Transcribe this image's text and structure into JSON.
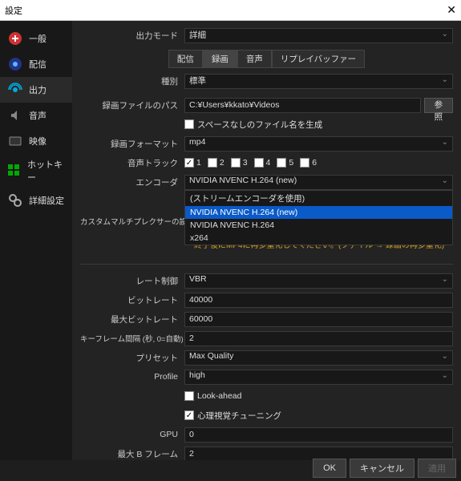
{
  "window": {
    "title": "設定"
  },
  "sidebar": {
    "items": [
      {
        "label": "一般",
        "icon": "general"
      },
      {
        "label": "配信",
        "icon": "stream"
      },
      {
        "label": "出力",
        "icon": "output"
      },
      {
        "label": "音声",
        "icon": "audio"
      },
      {
        "label": "映像",
        "icon": "video"
      },
      {
        "label": "ホットキー",
        "icon": "hotkey"
      },
      {
        "label": "詳細設定",
        "icon": "advanced"
      }
    ]
  },
  "outputMode": {
    "label": "出力モード",
    "value": "詳細"
  },
  "tabs": [
    "配信",
    "録画",
    "音声",
    "リプレイバッファー"
  ],
  "type": {
    "label": "種別",
    "value": "標準"
  },
  "recPath": {
    "label": "録画ファイルのパス",
    "value": "C:¥Users¥kkato¥Videos",
    "browse": "参照"
  },
  "noSpace": {
    "label": "スペースなしのファイル名を生成"
  },
  "recFormat": {
    "label": "録画フォーマット",
    "value": "mp4"
  },
  "audioTrack": {
    "label": "音声トラック",
    "tracks": [
      "1",
      "2",
      "3",
      "4",
      "5",
      "6"
    ]
  },
  "encoder": {
    "label": "エンコーダ",
    "value": "NVIDIA NVENC H.264 (new)",
    "options": [
      "(ストリームエンコーダを使用)",
      "NVIDIA NVENC H.264 (new)",
      "NVIDIA NVENC H.264",
      "x264"
    ]
  },
  "muxer": {
    "label": "カスタムマルチプレクサーの設定",
    "value": ""
  },
  "warning": "警告: MP4ファイルをファイナライズ出来ない場合(例えば、BSOD、電力損失などの結果として)はMP4に保存された録画は回復不能になります。複数の音声トラックを録画する場合はMKVの利用を検討して録画の終了後にMP4に再多重化してください。(ファイル → 録画の再多重化)",
  "rateControl": {
    "label": "レート制御",
    "value": "VBR"
  },
  "bitrate": {
    "label": "ビットレート",
    "value": "40000"
  },
  "maxBitrate": {
    "label": "最大ビットレート",
    "value": "60000"
  },
  "keyframe": {
    "label": "キーフレーム間隔 (秒, 0=自動)",
    "value": "2"
  },
  "preset": {
    "label": "プリセット",
    "value": "Max Quality"
  },
  "profile": {
    "label": "Profile",
    "value": "high"
  },
  "lookahead": {
    "label": "Look-ahead"
  },
  "psyTuning": {
    "label": "心理視覚チューニング"
  },
  "gpu": {
    "label": "GPU",
    "value": "0"
  },
  "bframes": {
    "label": "最大 B フレーム",
    "value": "2"
  },
  "buttons": {
    "ok": "OK",
    "cancel": "キャンセル",
    "apply": "適用"
  }
}
